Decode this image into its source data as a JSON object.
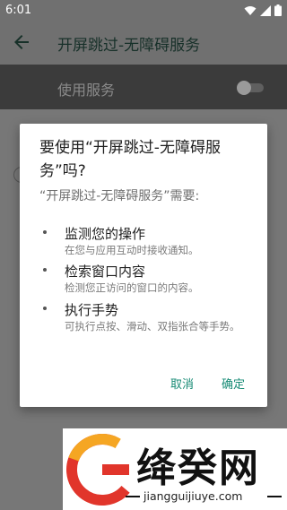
{
  "status_bar": {
    "time": "6:01",
    "icons": [
      "wifi-icon",
      "signal-icon",
      "battery-icon"
    ]
  },
  "app_bar": {
    "title": "开屏跳过-无障碍服务"
  },
  "service_toggle": {
    "label": "使用服务",
    "enabled": false
  },
  "dialog": {
    "title": "要使用“开屏跳过-无障碍服务”吗?",
    "subtitle": "“开屏跳过-无障碍服务”需要:",
    "permissions": [
      {
        "title": "监测您的操作",
        "desc": "在您与应用互动时接收通知。"
      },
      {
        "title": "检索窗口内容",
        "desc": "检测您正访问的窗口的内容。"
      },
      {
        "title": "执行手势",
        "desc": "可执行点按、滑动、双指张合等手势。"
      }
    ],
    "cancel_label": "取消",
    "ok_label": "确定"
  },
  "watermark": {
    "brand": "绛癸网",
    "url": "jiangguijiuye.com"
  },
  "colors": {
    "accent": "#168a74",
    "scrim": "#707070"
  }
}
